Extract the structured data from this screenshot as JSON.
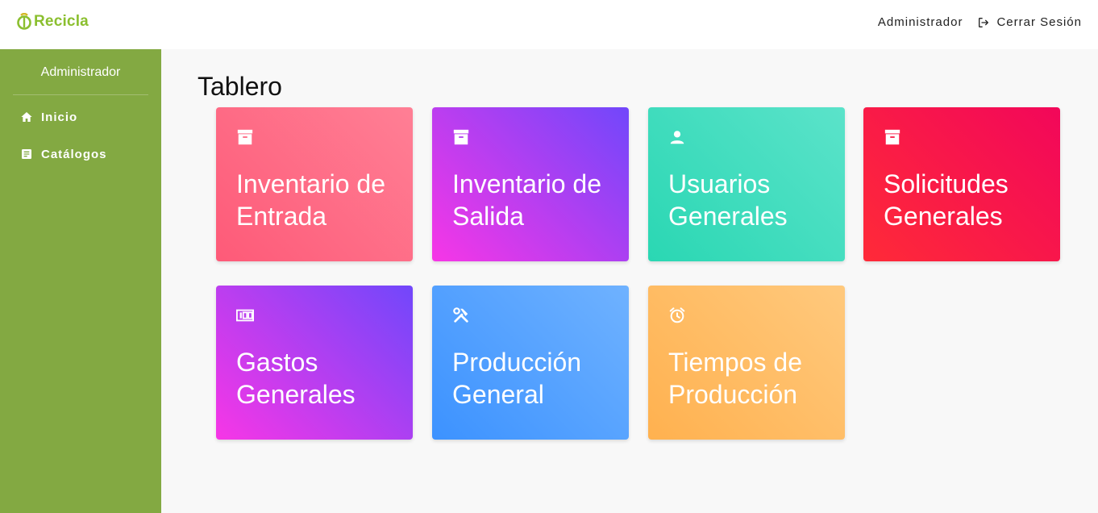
{
  "app": {
    "logo_text": "Recicla",
    "brand_color": "#8bbf2f"
  },
  "header": {
    "user_label": "Administrador",
    "logout_label": "Cerrar Sesión"
  },
  "sidebar": {
    "background": "#83a942",
    "user_label": "Administrador",
    "items": [
      {
        "label": "Inicio",
        "icon": "home-icon"
      },
      {
        "label": "Catálogos",
        "icon": "document-icon"
      }
    ]
  },
  "main": {
    "title": "Tablero",
    "cards": [
      {
        "label": "Inventario de Entrada",
        "icon": "archive-icon"
      },
      {
        "label": "Inventario de Salida",
        "icon": "archive-icon"
      },
      {
        "label": "Usuarios Generales",
        "icon": "person-icon"
      },
      {
        "label": "Solicitudes Generales",
        "icon": "archive-icon"
      },
      {
        "label": "Gastos Generales",
        "icon": "money-icon"
      },
      {
        "label": "Producción General",
        "icon": "tools-icon"
      },
      {
        "label": "Tiempos de Producción",
        "icon": "alarm-clock-icon"
      }
    ]
  }
}
